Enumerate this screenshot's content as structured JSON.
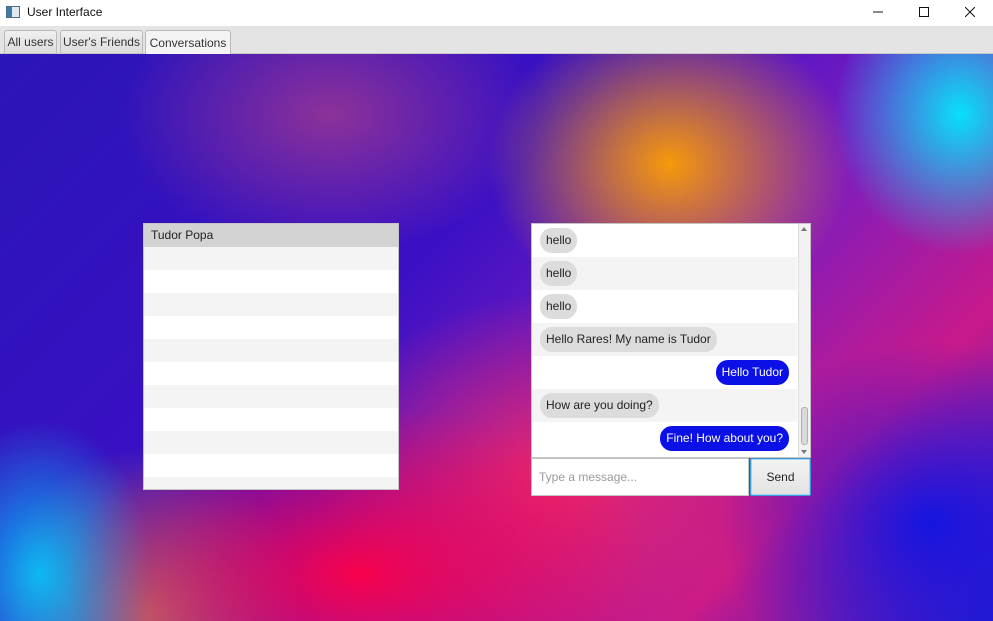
{
  "window": {
    "title": "User Interface",
    "icon": "app-window-icon",
    "controls": [
      "minimize-icon",
      "maximize-icon",
      "close-icon"
    ]
  },
  "tabs": [
    {
      "label": "All users",
      "active": false
    },
    {
      "label": "User's Friends",
      "active": false
    },
    {
      "label": "Conversations",
      "active": true
    }
  ],
  "user_list": {
    "items": [
      {
        "name": "Tudor Popa",
        "selected": true
      }
    ]
  },
  "chat": {
    "messages": [
      {
        "text": "hello",
        "direction": "incoming"
      },
      {
        "text": "hello",
        "direction": "incoming"
      },
      {
        "text": "hello",
        "direction": "incoming"
      },
      {
        "text": "Hello Rares! My name is Tudor",
        "direction": "incoming"
      },
      {
        "text": "Hello Tudor",
        "direction": "outgoing"
      },
      {
        "text": "How are you doing?",
        "direction": "incoming"
      },
      {
        "text": "Fine! How about you?",
        "direction": "outgoing"
      }
    ],
    "colors": {
      "outgoing_bubble": "#0a10e6",
      "incoming_bubble": "#dcdcdc"
    }
  },
  "composer": {
    "placeholder": "Type a message...",
    "value": "",
    "send_label": "Send"
  }
}
